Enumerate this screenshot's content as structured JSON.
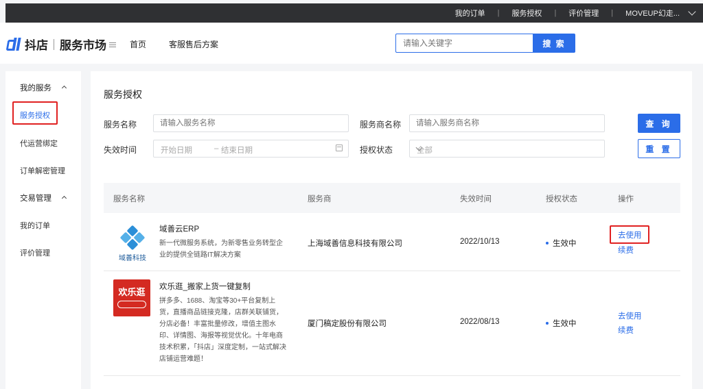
{
  "topbar": {
    "links": [
      "我的订单",
      "服务授权",
      "评价管理",
      "MOVEUP幻走..."
    ]
  },
  "header": {
    "brand": "抖店",
    "market": "服务市场",
    "nav": [
      "首页",
      "客服售后方案"
    ],
    "search_placeholder": "请输入关键字",
    "search_button": "搜 索"
  },
  "sidebar": {
    "groups": [
      {
        "label": "我的服务",
        "items": [
          "服务授权",
          "代运营绑定",
          "订单解密管理"
        ]
      },
      {
        "label": "交易管理",
        "items": [
          "我的订单",
          "评价管理"
        ]
      }
    ],
    "active": "服务授权"
  },
  "main": {
    "title": "服务授权",
    "filters": {
      "service_name_label": "服务名称",
      "service_name_placeholder": "请输入服务名称",
      "provider_label": "服务商名称",
      "provider_placeholder": "请输入服务商名称",
      "expire_label": "失效时间",
      "start_placeholder": "开始日期",
      "range_sep": "–",
      "end_placeholder": "结束日期",
      "status_label": "授权状态",
      "status_value": "全部",
      "query_button": "查 询",
      "reset_button": "重 置"
    },
    "table": {
      "columns": [
        "服务名称",
        "服务商",
        "失效时间",
        "授权状态",
        "操作"
      ],
      "rows": [
        {
          "logo_caption": "域善科技",
          "name": "域善云ERP",
          "desc": "新一代微服务系统，为新零售业务转型企业的提供全链路IT解决方案",
          "provider": "上海域善信息科技有限公司",
          "expire": "2022/10/13",
          "status": "生效中",
          "action_use": "去使用",
          "action_renew": "续费"
        },
        {
          "logo_caption": "欢乐逛",
          "name": "欢乐逛_搬家上货一键复制",
          "desc": "拼多多、1688、淘宝等30+平台复制上货，直播商品链接克隆，店群关联铺货，分店必备！丰富批量修改，增值主图水印、详情图、海报等视觉优化。十年电商技术积累，「抖店」深度定制，一站式解决店铺运营难题！",
          "provider": "厦门稿定股份有限公司",
          "expire": "2022/08/13",
          "status": "生效中",
          "action_use": "去使用",
          "action_renew": "续费"
        }
      ]
    }
  },
  "colors": {
    "accent": "#2b6de8",
    "highlight": "#e02020",
    "topbar": "#2f3033"
  }
}
